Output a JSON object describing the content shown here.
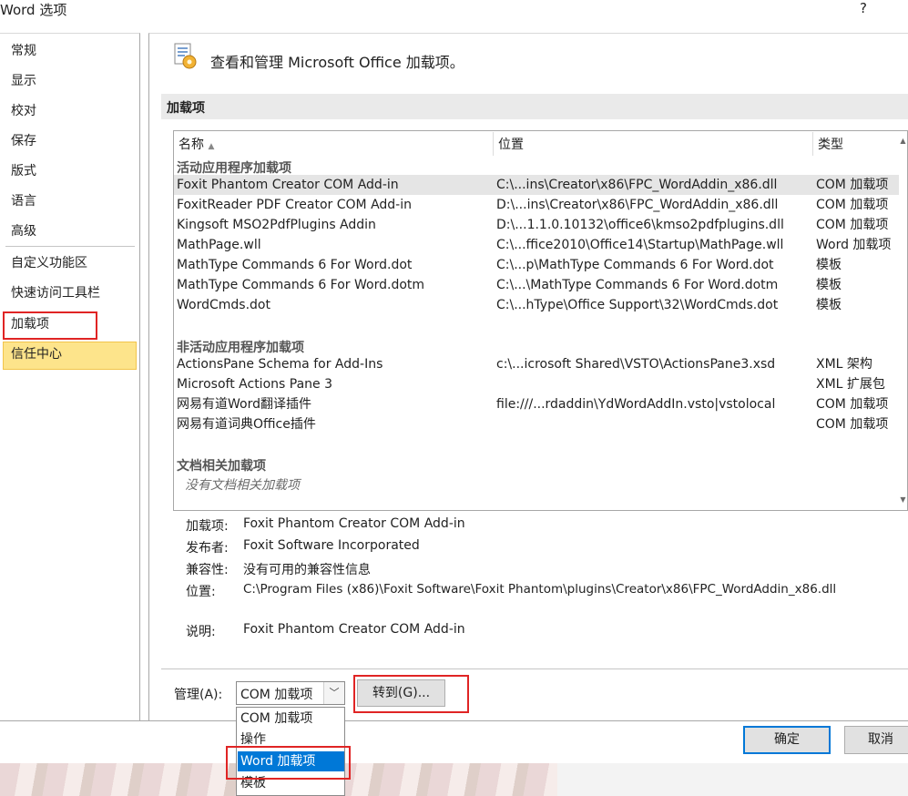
{
  "window": {
    "title": "Word 选项",
    "help": "?"
  },
  "nav": {
    "items": [
      "常规",
      "显示",
      "校对",
      "保存",
      "版式",
      "语言",
      "高级",
      "自定义功能区",
      "快速访问工具栏",
      "加载项",
      "信任中心"
    ],
    "selected": "加载项"
  },
  "header": {
    "text": "查看和管理 Microsoft Office 加载项。",
    "icon": "addins-gear-icon"
  },
  "section": {
    "label": "加载项"
  },
  "columns": {
    "name": "名称",
    "location": "位置",
    "type": "类型"
  },
  "groups": {
    "active": {
      "label": "活动应用程序加载项",
      "rows": [
        {
          "name": "Foxit Phantom Creator COM Add-in",
          "location": "C:\\...ins\\Creator\\x86\\FPC_WordAddin_x86.dll",
          "type": "COM 加载项"
        },
        {
          "name": "FoxitReader PDF Creator COM Add-in",
          "location": "D:\\...ins\\Creator\\x86\\FPC_WordAddin_x86.dll",
          "type": "COM 加载项"
        },
        {
          "name": "Kingsoft MSO2PdfPlugins Addin",
          "location": "D:\\...1.1.0.10132\\office6\\kmso2pdfplugins.dll",
          "type": "COM 加载项"
        },
        {
          "name": "MathPage.wll",
          "location": "C:\\...ffice2010\\Office14\\Startup\\MathPage.wll",
          "type": "Word 加载项"
        },
        {
          "name": "MathType Commands 6 For Word.dot",
          "location": "C:\\...p\\MathType Commands 6 For Word.dot",
          "type": "模板"
        },
        {
          "name": "MathType Commands 6 For Word.dotm",
          "location": "C:\\...\\MathType Commands 6 For Word.dotm",
          "type": "模板"
        },
        {
          "name": "WordCmds.dot",
          "location": "C:\\...hType\\Office Support\\32\\WordCmds.dot",
          "type": "模板"
        }
      ]
    },
    "inactive": {
      "label": "非活动应用程序加载项",
      "rows": [
        {
          "name": "ActionsPane Schema for Add-Ins",
          "location": "c:\\...icrosoft Shared\\VSTO\\ActionsPane3.xsd",
          "type": "XML 架构"
        },
        {
          "name": "Microsoft Actions Pane 3",
          "location": "",
          "type": "XML 扩展包"
        },
        {
          "name": "网易有道Word翻译插件",
          "location": "file:///...rdaddin\\YdWordAddIn.vsto|vstolocal",
          "type": "COM 加载项"
        },
        {
          "name": "网易有道词典Office插件",
          "location": "",
          "type": "COM 加载项"
        }
      ]
    },
    "document": {
      "label": "文档相关加载项",
      "empty": "没有文档相关加载项"
    }
  },
  "details": {
    "addin_label": "加载项:",
    "addin_value": "Foxit Phantom Creator COM Add-in",
    "publisher_label": "发布者:",
    "publisher_value": "Foxit Software Incorporated",
    "compat_label": "兼容性:",
    "compat_value": "没有可用的兼容性信息",
    "location_label": "位置:",
    "location_value": "C:\\Program Files (x86)\\Foxit Software\\Foxit Phantom\\plugins\\Creator\\x86\\FPC_WordAddin_x86.dll",
    "desc_label": "说明:",
    "desc_value": "Foxit Phantom Creator COM Add-in"
  },
  "manage": {
    "label": "管理(A):",
    "selected": "COM 加载项",
    "options": [
      "COM 加载项",
      "操作",
      "Word 加载项",
      "模板"
    ],
    "highlighted": "Word 加载项",
    "goto_label": "转到(G)..."
  },
  "buttons": {
    "ok": "确定",
    "cancel": "取消"
  },
  "colors": {
    "nav_selected": "#fde48b",
    "highlight_box": "#e02424",
    "dropdown_active": "#0078d7"
  }
}
